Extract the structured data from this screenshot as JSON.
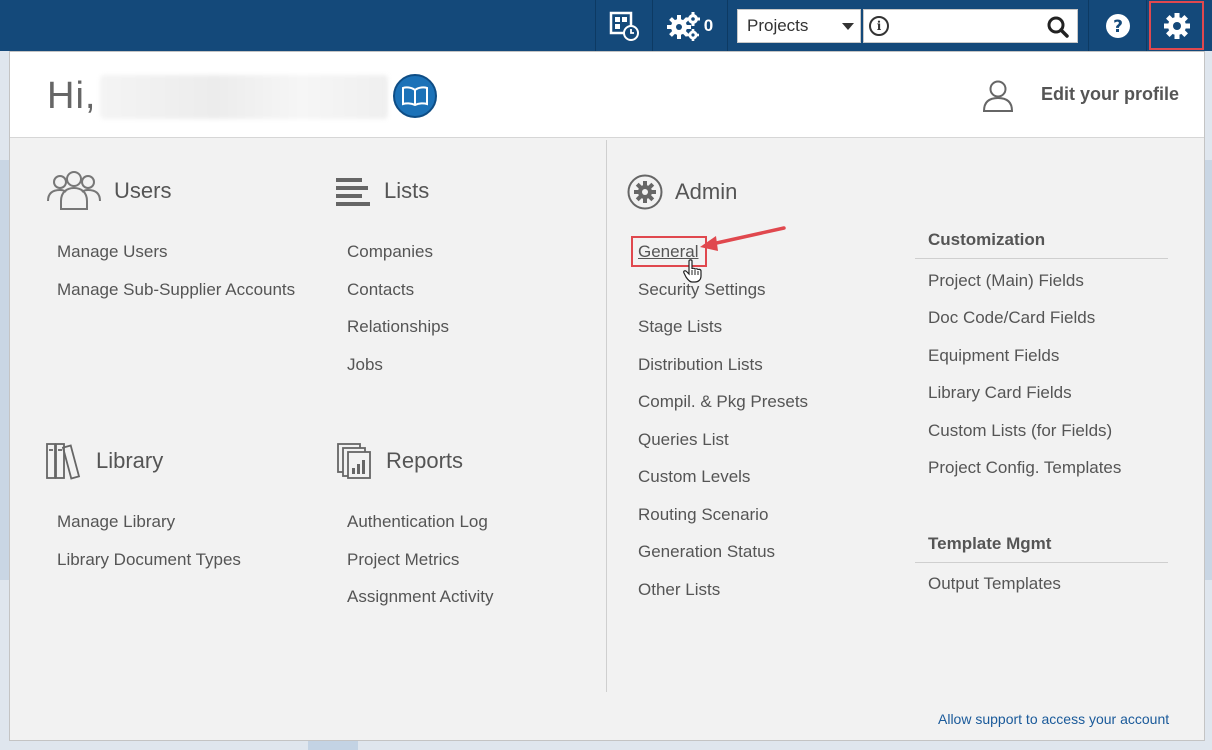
{
  "topbar": {
    "jobs_count": "0",
    "project_select": {
      "value": "Projects"
    },
    "search": {
      "placeholder": ""
    },
    "icons": [
      "dashboard-clock-icon",
      "gears-icon",
      "info-icon",
      "search-icon",
      "help-icon",
      "settings-gear-icon"
    ]
  },
  "header": {
    "greeting": "Hi,",
    "edit_profile": "Edit your profile"
  },
  "sections": {
    "users": {
      "title": "Users",
      "items": [
        "Manage Users",
        "Manage Sub-Supplier Accounts"
      ]
    },
    "lists": {
      "title": "Lists",
      "items": [
        "Companies",
        "Contacts",
        "Relationships",
        "Jobs"
      ]
    },
    "library": {
      "title": "Library",
      "items": [
        "Manage Library",
        "Library Document Types"
      ]
    },
    "reports": {
      "title": "Reports",
      "items": [
        "Authentication Log",
        "Project Metrics",
        "Assignment Activity"
      ]
    },
    "admin": {
      "title": "Admin",
      "items": [
        "General",
        "Security Settings",
        "Stage Lists",
        "Distribution Lists",
        "Compil. & Pkg Presets",
        "Queries List",
        "Custom Levels",
        "Routing Scenario",
        "Generation Status",
        "Other Lists"
      ]
    },
    "customization": {
      "title": "Customization",
      "items": [
        "Project (Main) Fields",
        "Doc Code/Card Fields",
        "Equipment Fields",
        "Library Card Fields",
        "Custom Lists (for Fields)",
        "Project Config. Templates"
      ]
    },
    "template_mgmt": {
      "title": "Template Mgmt",
      "items": [
        "Output Templates"
      ]
    }
  },
  "footer": {
    "support_link": "Allow support to access your account"
  },
  "colors": {
    "topbar": "#14497a",
    "highlight": "#e0484e",
    "link": "#1a5a9a"
  }
}
